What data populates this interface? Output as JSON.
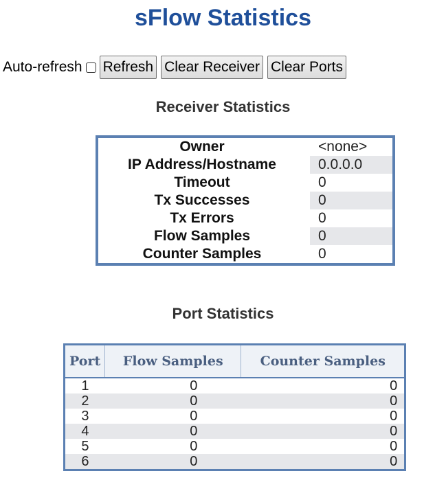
{
  "page": {
    "title": "sFlow Statistics"
  },
  "controls": {
    "auto_refresh_label": "Auto-refresh",
    "auto_refresh_checked": false,
    "refresh_label": "Refresh",
    "clear_receiver_label": "Clear Receiver",
    "clear_ports_label": "Clear Ports"
  },
  "receiver": {
    "title": "Receiver Statistics",
    "rows": [
      {
        "key": "Owner",
        "value": "<none>"
      },
      {
        "key": "IP Address/Hostname",
        "value": "0.0.0.0"
      },
      {
        "key": "Timeout",
        "value": "0"
      },
      {
        "key": "Tx Successes",
        "value": "0"
      },
      {
        "key": "Tx Errors",
        "value": "0"
      },
      {
        "key": "Flow Samples",
        "value": "0"
      },
      {
        "key": "Counter Samples",
        "value": "0"
      }
    ]
  },
  "ports": {
    "title": "Port Statistics",
    "headers": [
      "Port",
      "Flow Samples",
      "Counter Samples"
    ],
    "rows": [
      {
        "port": "1",
        "flow": "0",
        "counter": "0"
      },
      {
        "port": "2",
        "flow": "0",
        "counter": "0"
      },
      {
        "port": "3",
        "flow": "0",
        "counter": "0"
      },
      {
        "port": "4",
        "flow": "0",
        "counter": "0"
      },
      {
        "port": "5",
        "flow": "0",
        "counter": "0"
      },
      {
        "port": "6",
        "flow": "0",
        "counter": "0"
      }
    ]
  },
  "colors": {
    "title": "#1f4f9a",
    "table_border": "#5b80b2",
    "row_stripe": "#e6e7ea"
  }
}
